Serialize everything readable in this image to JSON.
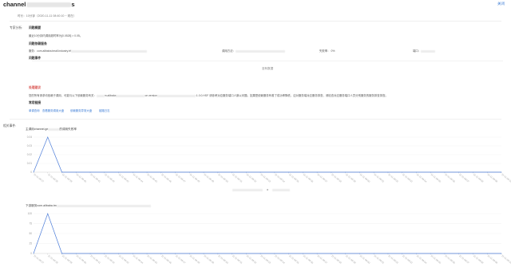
{
  "header": {
    "title_prefix": "channel",
    "title_suffix": "s",
    "close_label": "关闭",
    "subtitle": "时长：10分钟（2020-11-11 08:40:10 ~ 现在）"
  },
  "analysis": {
    "section_label": "专家分析:",
    "overview_title": "问题概要",
    "overview_text": "最近10分钟内调用超时率为[0.0528] > 0.05。",
    "service_title": "问题依赖服务",
    "service_label": "服务：com.alibaba.tmall.industry.trf",
    "method_label": "调用方法：",
    "fail_label": "失败率：",
    "fail_value": "0%",
    "port_label": "端口："
  },
  "events": {
    "title": "问题事件",
    "empty_text": "没有数据"
  },
  "advice": {
    "title": "处理建议",
    "text_a": "您的所有请求均依赖于调用，可能与以下依赖服务有关：",
    "text_b": "m.alibaba",
    "text_c": "ce.version",
    "text_d": ":1.0.0.HSF 请参考对应服务端口人脉以问题。如果是依赖服务有着了成功率降低，应对服务端对应服务排查，请检查对应服务端口人员分别服务的服务排查排查。",
    "links_title": "常用链接",
    "links": [
      "单调查询",
      "查看服务调用大盘",
      "依赖服务异常大盘",
      "链路日志"
    ]
  },
  "related": {
    "section_label": "相关事件:"
  },
  "chart_data": [
    {
      "type": "line",
      "title_prefix": "主调用channel.ge",
      "title_suffix": "的调用失败率",
      "yticks": [
        "0.04",
        "0.03",
        "0.02",
        "0.01",
        "0"
      ],
      "ylim": [
        0,
        0.04
      ],
      "x": [
        "11-11 08:37",
        "11-11 08:38",
        "11-11 08:39",
        "11-11 08:40",
        "11-11 08:41",
        "11-11 08:42",
        "11-11 08:43",
        "11-11 08:44",
        "11-11 08:45",
        "11-11 08:46",
        "11-11 08:47",
        "11-11 08:48",
        "11-11 08:49",
        "11-11 08:50",
        "11-11 08:51",
        "11-11 08:52",
        "11-11 08:53",
        "11-11 08:54",
        "11-11 08:55",
        "11-11 08:56",
        "11-11 08:57",
        "11-11 08:58",
        "11-11 08:59",
        "11-11 09:00",
        "11-11 09:01",
        "11-11 09:02",
        "11-11 09:03",
        "11-11 09:04",
        "11-11 09:05",
        "11-11 09:06",
        "11-11 09:07",
        "11-11 09:08",
        "11-11 09:09",
        "11-11 09:10"
      ],
      "values": [
        0,
        0.04,
        0,
        0,
        0,
        0,
        0,
        0,
        0,
        0,
        0,
        0,
        0,
        0,
        0,
        0,
        0,
        0,
        0,
        0,
        0,
        0,
        0,
        0,
        0,
        0,
        0,
        0,
        0,
        0,
        0,
        0,
        0,
        0
      ],
      "legend": "a",
      "color": "#4a7bd8"
    },
    {
      "type": "line",
      "title_prefix": "下游服务com.alibaba.tm",
      "title_suffix": "",
      "yticks": [
        "100",
        "75",
        "50",
        "25",
        "0"
      ],
      "ylim": [
        0,
        100
      ],
      "x": [
        "11-11 08:37",
        "11-11 08:38",
        "11-11 08:39",
        "11-11 08:40",
        "11-11 08:41",
        "11-11 08:42",
        "11-11 08:43",
        "11-11 08:44",
        "11-11 08:45",
        "11-11 08:46",
        "11-11 08:47",
        "11-11 08:48",
        "11-11 08:49",
        "11-11 08:50",
        "11-11 08:51",
        "11-11 08:52",
        "11-11 08:53",
        "11-11 08:54",
        "11-11 08:55",
        "11-11 08:56",
        "11-11 08:57",
        "11-11 08:58",
        "11-11 08:59",
        "11-11 09:00",
        "11-11 09:01",
        "11-11 09:02",
        "11-11 09:03",
        "11-11 09:04",
        "11-11 09:05",
        "11-11 09:06",
        "11-11 09:07",
        "11-11 09:08",
        "11-11 09:09",
        "11-11 09:10"
      ],
      "values": [
        0,
        100,
        0,
        0,
        0,
        0,
        0,
        0,
        0,
        0,
        0,
        0,
        0,
        0,
        0,
        0,
        0,
        0,
        0,
        0,
        0,
        0,
        0,
        0,
        0,
        0,
        0,
        0,
        0,
        0,
        0,
        0,
        0,
        0
      ],
      "color": "#4a7bd8"
    }
  ]
}
